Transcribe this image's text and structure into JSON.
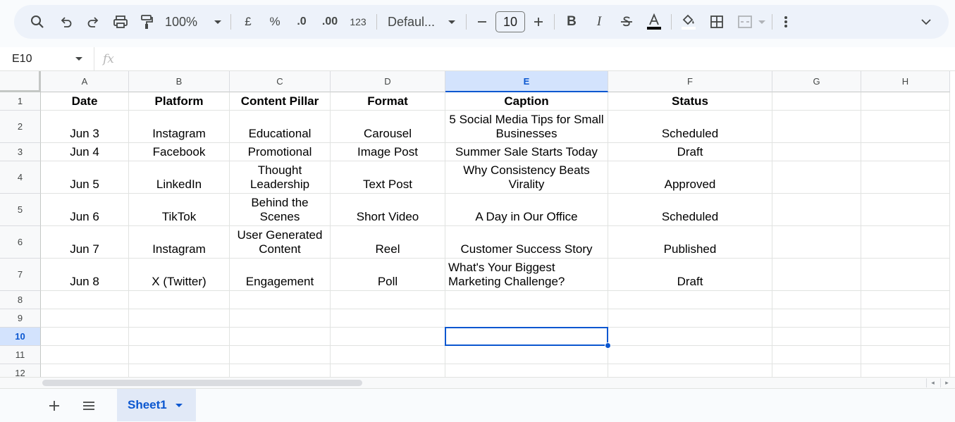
{
  "toolbar": {
    "zoom": "100%",
    "currency_symbol": "£",
    "percent_symbol": "%",
    "decrease_decimal": ".0",
    "increase_decimal": ".00",
    "number_format": "123",
    "font": "Defaul...",
    "font_size": "10",
    "text_color": "#000000",
    "icons": [
      "search-icon",
      "undo-icon",
      "redo-icon",
      "print-icon",
      "paint-format-icon",
      "minus-icon",
      "plus-icon",
      "bold-icon",
      "italic-icon",
      "strikethrough-icon",
      "text-color-icon",
      "fill-color-icon",
      "borders-icon",
      "merge-cells-icon",
      "more-vert-icon",
      "collapse-chevron-icon"
    ]
  },
  "formula_bar": {
    "cell_ref": "E10",
    "fx": "fx",
    "content": ""
  },
  "grid": {
    "columns": [
      "A",
      "B",
      "C",
      "D",
      "E",
      "F",
      "G",
      "H"
    ],
    "selected_column": "E",
    "row_numbers": [
      "1",
      "2",
      "3",
      "4",
      "5",
      "6",
      "7",
      "8",
      "9",
      "10",
      "11",
      "12"
    ],
    "selected_row": "10",
    "selected_cell": "E10",
    "rows": [
      [
        "Date",
        "Platform",
        "Content Pillar",
        "Format",
        "Caption",
        "Status",
        "",
        ""
      ],
      [
        "Jun 3",
        "Instagram",
        "Educational",
        "Carousel",
        "5 Social Media Tips for Small Businesses",
        "Scheduled",
        "",
        ""
      ],
      [
        "Jun 4",
        "Facebook",
        "Promotional",
        "Image Post",
        "Summer Sale Starts Today",
        "Draft",
        "",
        ""
      ],
      [
        "Jun 5",
        "LinkedIn",
        "Thought Leadership",
        "Text Post",
        "Why Consistency Beats Virality",
        "Approved",
        "",
        ""
      ],
      [
        "Jun 6",
        "TikTok",
        "Behind the Scenes",
        "Short Video",
        "A Day in Our Office",
        "Scheduled",
        "",
        ""
      ],
      [
        "Jun 7",
        "Instagram",
        "User Generated Content",
        "Reel",
        "Customer Success Story",
        "Published",
        "",
        ""
      ],
      [
        "Jun 8",
        "X (Twitter)",
        "Engagement",
        "Poll",
        "What's Your Biggest Marketing Challenge?",
        "Draft",
        "",
        ""
      ],
      [
        "",
        "",
        "",
        "",
        "",
        "",
        "",
        ""
      ],
      [
        "",
        "",
        "",
        "",
        "",
        "",
        "",
        ""
      ],
      [
        "",
        "",
        "",
        "",
        "",
        "",
        "",
        ""
      ],
      [
        "",
        "",
        "",
        "",
        "",
        "",
        "",
        ""
      ],
      [
        "",
        "",
        "",
        "",
        "",
        "",
        "",
        ""
      ]
    ]
  },
  "sheets": {
    "tabs": [
      {
        "label": "Sheet1",
        "active": true
      }
    ]
  },
  "colors": {
    "accent": "#0b57d0",
    "toolbar_bg": "#edf2fa",
    "selected_header_bg": "#d3e3fd"
  }
}
